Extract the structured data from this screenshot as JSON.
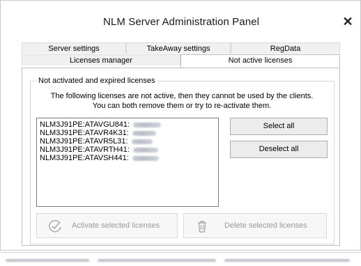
{
  "window": {
    "title": "NLM Server Administration Panel",
    "close_glyph": "✕"
  },
  "tabs": {
    "row1": [
      "Server settings",
      "TakeAway settings",
      "RegData"
    ],
    "row2": [
      "Licenses manager",
      "Not active licenses"
    ],
    "active": "Not active licenses"
  },
  "group": {
    "label": "Not activated and expired licenses",
    "description_line1": "The following licenses are not active, then they cannot be used by the clients.",
    "description_line2": "You can both remove them or try to re-activate them."
  },
  "licenses": [
    {
      "id": "NLM3J91PE:ATAVGU841:",
      "value_redacted": true
    },
    {
      "id": "NLM3J91PE:ATAVR4K31:",
      "value_redacted": true
    },
    {
      "id": "NLM3J91PE:ATAVR5L31:",
      "value_redacted": true
    },
    {
      "id": "NLM3J91PE:ATAVRTH41:",
      "value_redacted": true
    },
    {
      "id": "NLM3J91PE:ATAVSH441:",
      "value_redacted": true
    }
  ],
  "buttons": {
    "select_all": "Select all",
    "deselect_all": "Deselect all",
    "activate": "Activate selected licenses",
    "delete": "Delete selected licenses"
  },
  "icons": {
    "activate": "checkmark-circle-icon",
    "delete": "trash-icon",
    "close": "close-icon"
  },
  "colors": {
    "disabled_text": "#9a9a9a",
    "border": "#adadad"
  }
}
